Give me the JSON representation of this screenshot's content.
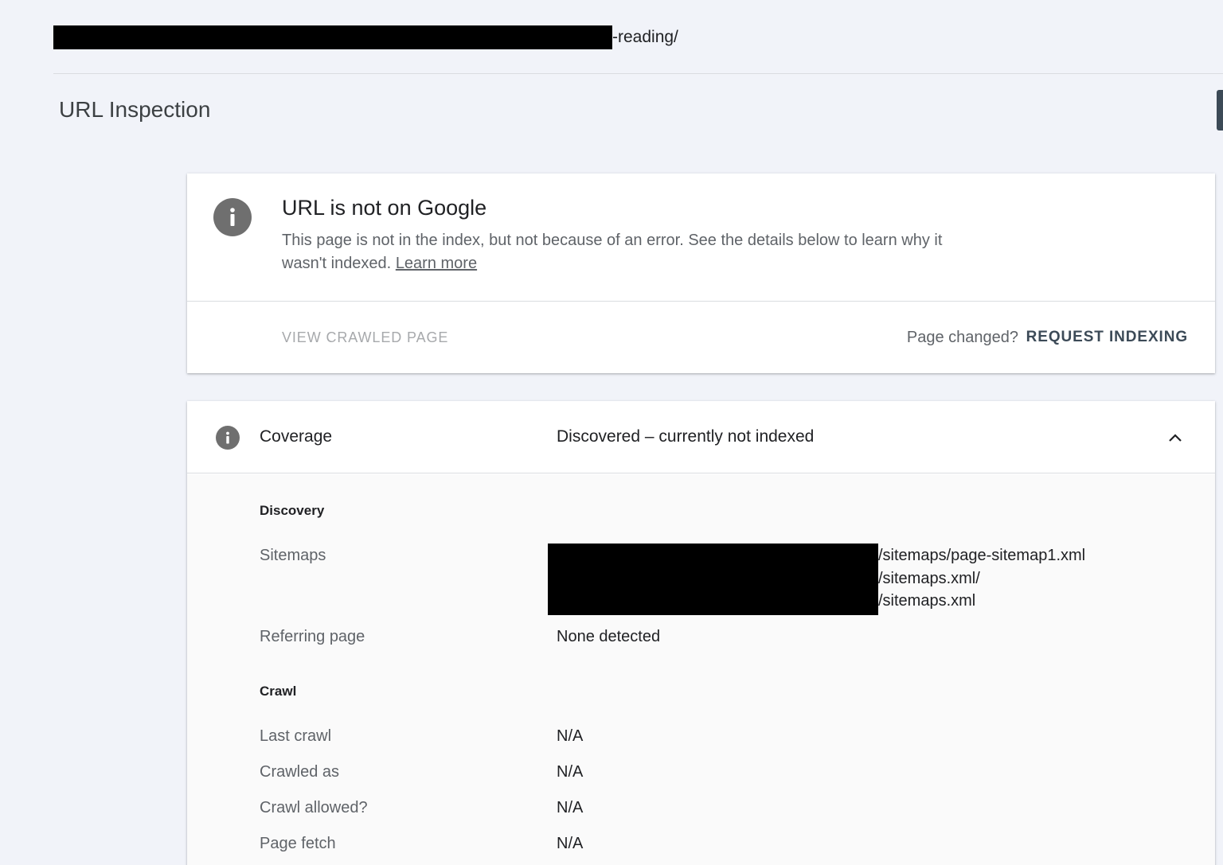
{
  "header": {
    "url_suffix": "-reading/",
    "page_title": "URL Inspection"
  },
  "status_card": {
    "icon": "info-icon",
    "title": "URL is not on Google",
    "description": "This page is not in the index, but not because of an error. See the details below to learn why it wasn't indexed.",
    "learn_more": "Learn more",
    "view_crawled_page": "VIEW CRAWLED PAGE",
    "page_changed": "Page changed?",
    "request_indexing": "REQUEST INDEXING"
  },
  "coverage": {
    "icon": "info-icon",
    "label": "Coverage",
    "value": "Discovered – currently not indexed",
    "discovery": {
      "heading": "Discovery",
      "sitemaps_label": "Sitemaps",
      "sitemaps": [
        "/sitemaps/page-sitemap1.xml",
        "/sitemaps.xml/",
        "/sitemaps.xml"
      ],
      "referring_page_label": "Referring page",
      "referring_page_value": "None detected"
    },
    "crawl": {
      "heading": "Crawl",
      "rows": [
        {
          "label": "Last crawl",
          "value": "N/A"
        },
        {
          "label": "Crawled as",
          "value": "N/A"
        },
        {
          "label": "Crawl allowed?",
          "value": "N/A"
        },
        {
          "label": "Page fetch",
          "value": "N/A"
        }
      ]
    }
  },
  "colors": {
    "background": "#f1f3f9",
    "accent": "#3c4a57",
    "icon_gray": "#6f6f6f"
  }
}
